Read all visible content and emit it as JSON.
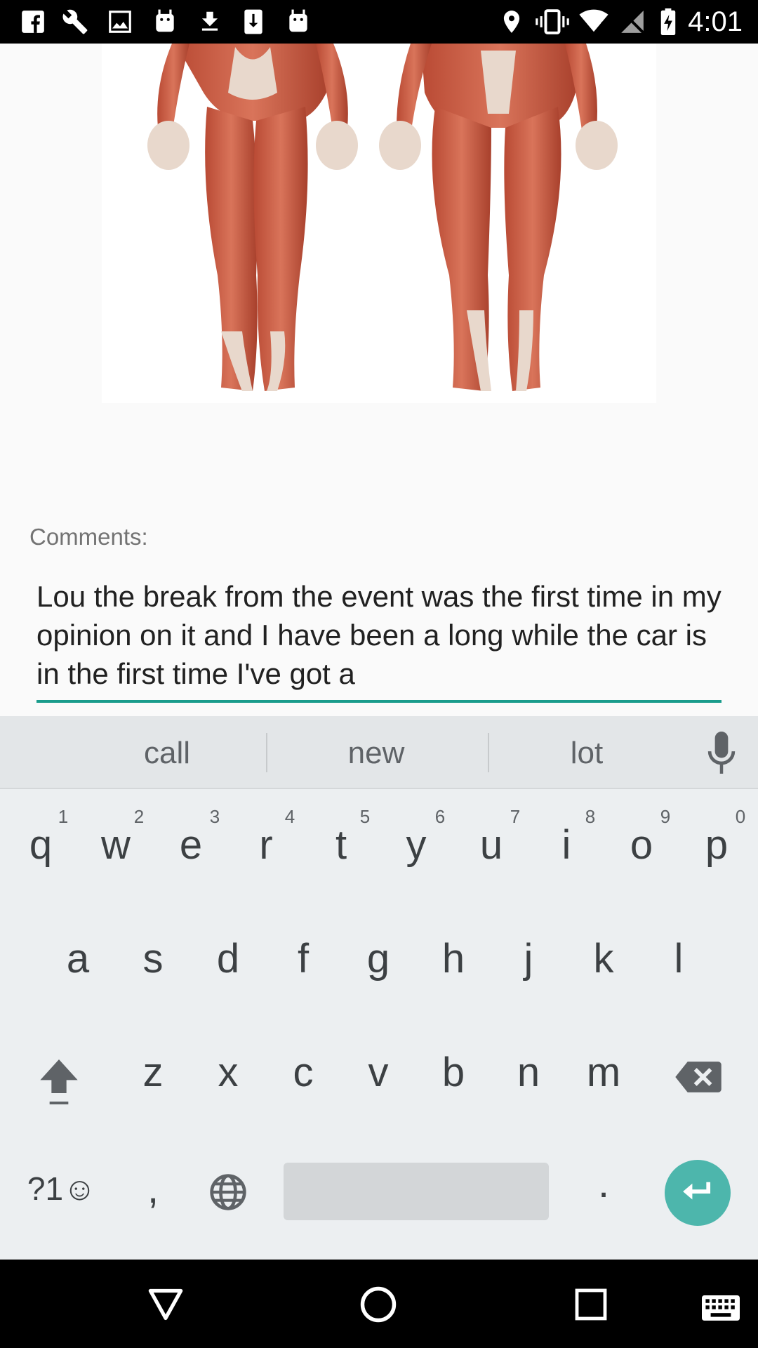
{
  "status_bar": {
    "time": "4:01",
    "left_icons": [
      "facebook-icon",
      "wrench-icon",
      "image-icon",
      "android-icon",
      "download-icon",
      "download-box-icon",
      "android-icon"
    ],
    "right_icons": [
      "location-icon",
      "vibrate-icon",
      "wifi-icon",
      "no-signal-icon",
      "battery-charging-icon"
    ]
  },
  "content": {
    "image": "anatomy-muscles-image",
    "comments_label": "Comments:",
    "comment_value": "Lou the break from the event was the first time in my opinion on it and I have been a long while the car is in the first time I've got a"
  },
  "keyboard": {
    "suggestions": [
      "call",
      "new",
      "lot"
    ],
    "row1": [
      "q",
      "w",
      "e",
      "r",
      "t",
      "y",
      "u",
      "i",
      "o",
      "p"
    ],
    "row1_hints": [
      "1",
      "2",
      "3",
      "4",
      "5",
      "6",
      "7",
      "8",
      "9",
      "0"
    ],
    "row2": [
      "a",
      "s",
      "d",
      "f",
      "g",
      "h",
      "j",
      "k",
      "l"
    ],
    "row3": [
      "z",
      "x",
      "c",
      "v",
      "b",
      "n",
      "m"
    ],
    "symbols_label": "?1☺",
    "comma": ",",
    "period": ".",
    "accent_color": "#4db6ac"
  },
  "colors": {
    "field_underline": "#1a9c8c"
  }
}
